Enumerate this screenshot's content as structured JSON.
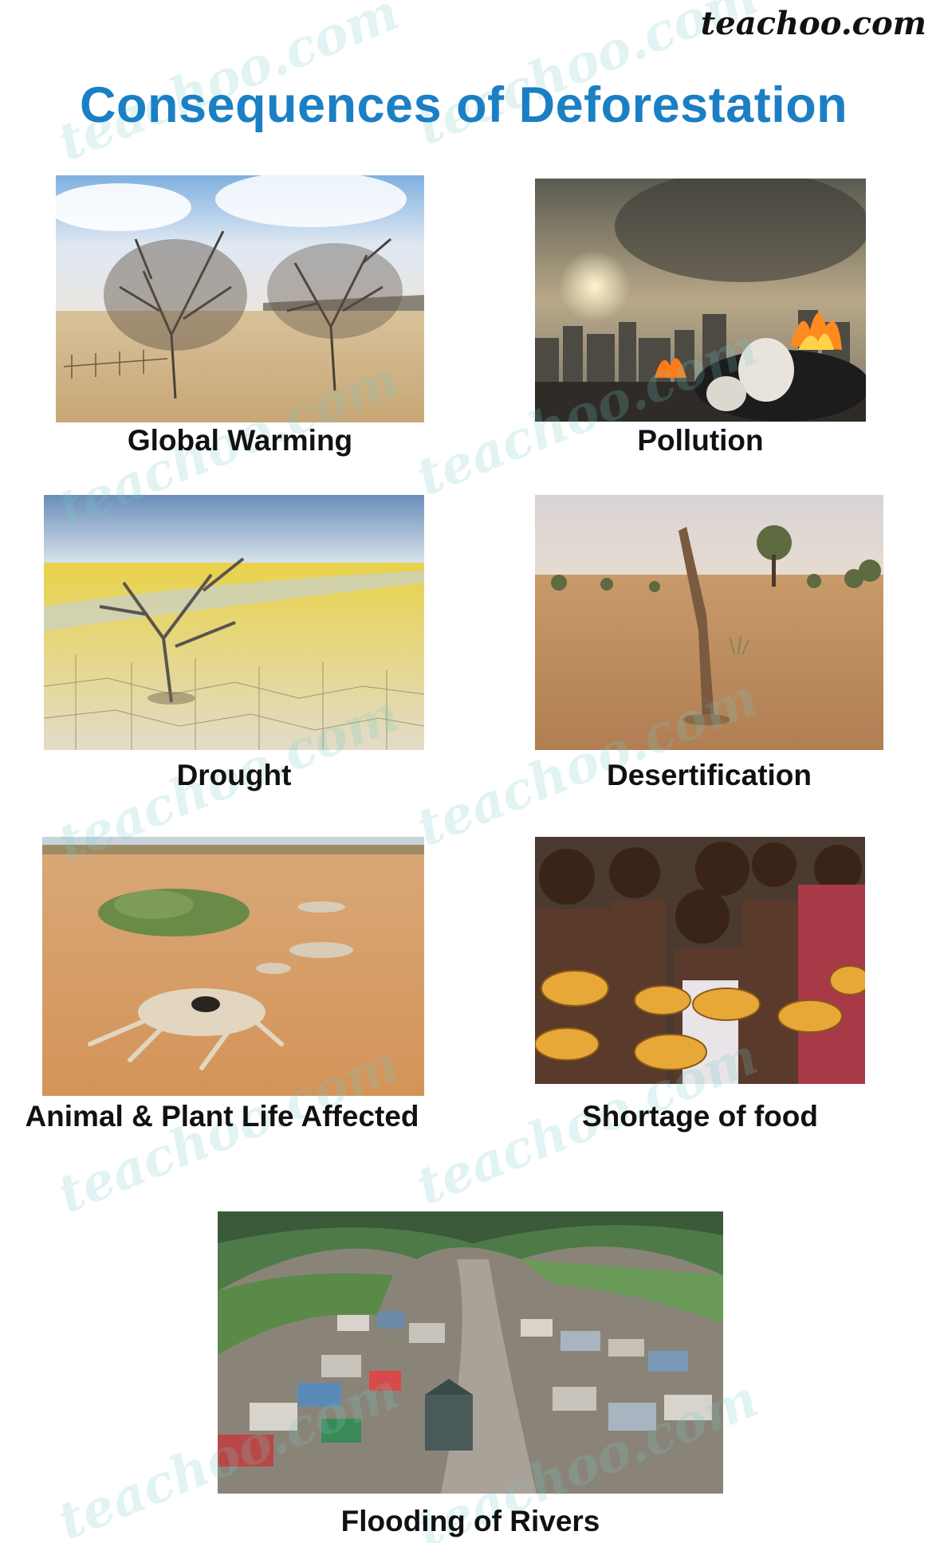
{
  "brand": "teachoo.com",
  "title": "Consequences of Deforestation",
  "title_color": "#1b7fc4",
  "watermark_text": "teachoo.com",
  "items": [
    {
      "caption": "Global Warming",
      "image": "dead-trees-dry-land-photo"
    },
    {
      "caption": "Pollution",
      "image": "burning-garbage-city-smog-photo"
    },
    {
      "caption": "Drought",
      "image": "dead-tree-cracked-earth-photo"
    },
    {
      "caption": "Desertification",
      "image": "dead-stump-barren-land-photo"
    },
    {
      "caption": "Animal & Plant Life Affected",
      "image": "animal-carcasses-dry-land-photo"
    },
    {
      "caption": "Shortage of food",
      "image": "children-holding-empty-bowls-photo"
    },
    {
      "caption": "Flooding of Rivers",
      "image": "flooded-valley-town-photo"
    }
  ]
}
